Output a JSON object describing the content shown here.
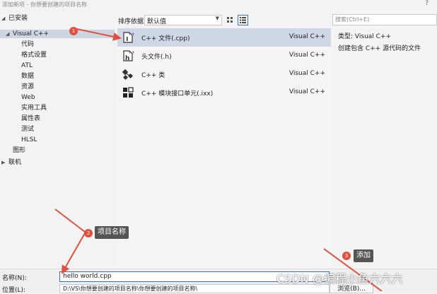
{
  "window": {
    "title": "添加新项 - 你想要创建的项目名称",
    "help": "?"
  },
  "tree": {
    "installed": "已安装",
    "visual_cpp": "Visual C++",
    "children": [
      "代码",
      "格式设置",
      "ATL",
      "数据",
      "资源",
      "Web",
      "实用工具",
      "属性表",
      "测试",
      "HLSL"
    ],
    "graphics": "图形",
    "online": "联机"
  },
  "sort": {
    "label": "排序依据:",
    "value": "默认值"
  },
  "templates": [
    {
      "name": "C++ 文件(.cpp)",
      "lang": "Visual C++",
      "icon": "cpp-file-icon"
    },
    {
      "name": "头文件(.h)",
      "lang": "Visual C++",
      "icon": "header-file-icon"
    },
    {
      "name": "C++ 类",
      "lang": "Visual C++",
      "icon": "cpp-class-icon"
    },
    {
      "name": "C++ 模块接口单元(.ixx)",
      "lang": "Visual C++",
      "icon": "module-interface-icon"
    }
  ],
  "search": {
    "placeholder": "搜索(Ctrl+E)"
  },
  "info": {
    "type_label": "类型:",
    "type_value": "Visual C++",
    "description": "创建包含 C++ 源代码的文件"
  },
  "form": {
    "name_label": "名称(N):",
    "name_value": "hello world.cpp",
    "location_label": "位置(L):",
    "location_value": "D:\\VS\\你想要创建的项目名称\\你想要创建的项目名称\\",
    "browse_label": "浏览(B)..."
  },
  "annotations": {
    "badge1": "1",
    "badge2": "2",
    "callout2": "项目名称",
    "badge3": "3",
    "callout3": "添加",
    "color": "#e0503e"
  },
  "watermark": "CSDN @编程小鱼六六六"
}
